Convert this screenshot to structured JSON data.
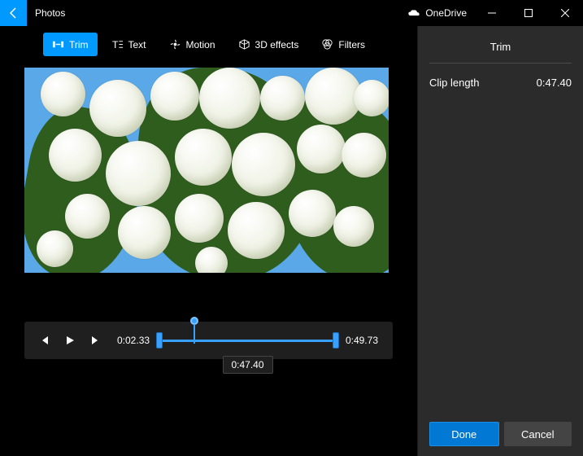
{
  "titlebar": {
    "app_name": "Photos",
    "onedrive_label": "OneDrive"
  },
  "toolbar": {
    "trim": "Trim",
    "text": "Text",
    "motion": "Motion",
    "effects": "3D effects",
    "filters": "Filters"
  },
  "controls": {
    "current_time": "0:02.33",
    "end_time": "0:49.73",
    "selected_duration": "0:47.40"
  },
  "sidepanel": {
    "title": "Trim",
    "clip_length_label": "Clip length",
    "clip_length_value": "0:47.40",
    "done": "Done",
    "cancel": "Cancel"
  }
}
